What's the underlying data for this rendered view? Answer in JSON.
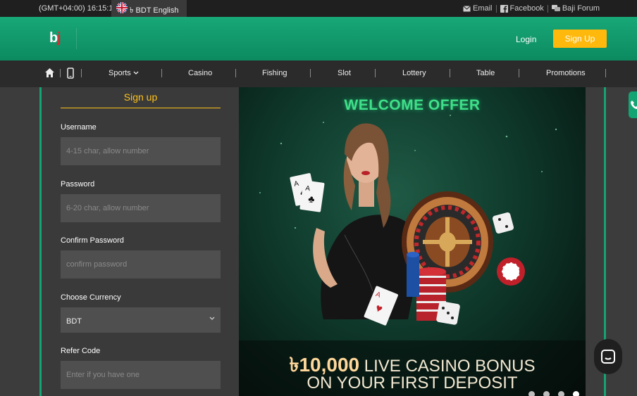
{
  "topbar": {
    "time": "(GMT+04:00) 16:15:10",
    "language": "৳ BDT English",
    "links": [
      {
        "label": "Email",
        "icon": "email-icon"
      },
      {
        "label": "Facebook",
        "icon": "facebook-icon"
      },
      {
        "label": "Baji Forum",
        "icon": "forum-icon"
      }
    ]
  },
  "header": {
    "logo": "bj",
    "login_label": "Login",
    "signup_label": "Sign Up",
    "accent": "#ffb80c",
    "brand_green": "#14a372"
  },
  "nav": {
    "items": [
      "Sports",
      "Casino",
      "Fishing",
      "Slot",
      "Lottery",
      "Table",
      "Promotions"
    ]
  },
  "signup_form": {
    "title": "Sign up",
    "username_label": "Username",
    "username_placeholder": "4-15 char, allow number",
    "password_label": "Password",
    "password_placeholder": "6-20 char, allow number",
    "confirm_label": "Confirm Password",
    "confirm_placeholder": "confirm password",
    "currency_label": "Choose Currency",
    "currency_value": "BDT",
    "refer_label": "Refer Code",
    "refer_placeholder": "Enter if you have one"
  },
  "banner": {
    "headline": "WELCOME OFFER",
    "amount": "৳10,000",
    "line1_rest": "LIVE CASINO BONUS",
    "line2": "ON YOUR FIRST DEPOSIT",
    "slide_count": 4,
    "active_slide": 4
  }
}
